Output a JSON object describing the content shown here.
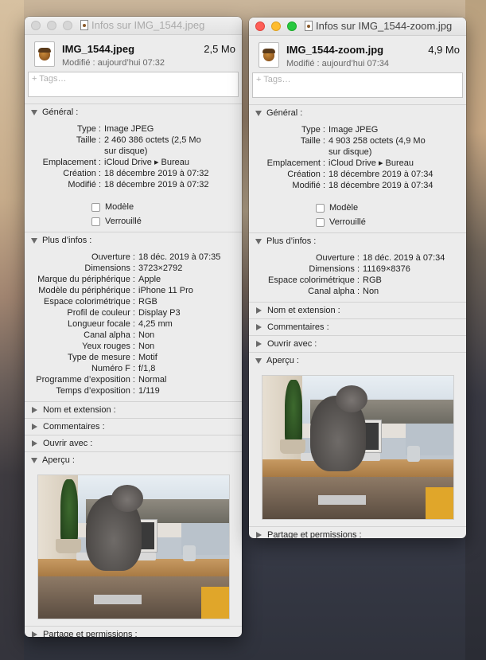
{
  "windows": [
    {
      "title": "Infos sur IMG_1544.jpeg",
      "filename": "IMG_1544.jpeg",
      "size": "2,5 Mo",
      "modified_line": "Modifié : aujourd’hui 07:32",
      "tags_placeholder": "+ Tags…",
      "general": {
        "label": "Général :",
        "type_k": "Type :",
        "type_v": "Image JPEG",
        "size_k": "Taille :",
        "size_v1": "2 460 386 octets (2,5 Mo",
        "size_v2": "sur disque)",
        "loc_k": "Emplacement :",
        "loc_v": "iCloud Drive ▸ Bureau",
        "created_k": "Création :",
        "created_v": "18 décembre 2019 à 07:32",
        "modified_k": "Modifié :",
        "modified_v": "18 décembre 2019 à 07:32",
        "template_label": "Modèle",
        "locked_label": "Verrouillé"
      },
      "more_info": {
        "label": "Plus d’infos :",
        "rows": [
          {
            "k": "Ouverture :",
            "v": "18 déc. 2019 à 07:35"
          },
          {
            "k": "Dimensions :",
            "v": "3723×2792"
          },
          {
            "k": "Marque du périphérique :",
            "v": "Apple"
          },
          {
            "k": "Modèle du périphérique :",
            "v": "iPhone 11 Pro"
          },
          {
            "k": "Espace colorimétrique :",
            "v": "RGB"
          },
          {
            "k": "Profil de couleur :",
            "v": "Display P3"
          },
          {
            "k": "Longueur focale :",
            "v": "4,25 mm"
          },
          {
            "k": "Canal alpha :",
            "v": "Non"
          },
          {
            "k": "Yeux rouges :",
            "v": "Non"
          },
          {
            "k": "Type de mesure :",
            "v": "Motif"
          },
          {
            "k": "Numéro F :",
            "v": "f/1,8"
          },
          {
            "k": "Programme d’exposition :",
            "v": "Normal"
          },
          {
            "k": "Temps d’exposition :",
            "v": "1/119"
          }
        ]
      },
      "name_ext": "Nom et extension :",
      "comments": "Commentaires :",
      "open_with": "Ouvrir avec :",
      "preview": "Aperçu :",
      "sharing": "Partage et permissions :"
    },
    {
      "title": "Infos sur IMG_1544-zoom.jpg",
      "filename": "IMG_1544-zoom.jpg",
      "size": "4,9 Mo",
      "modified_line": "Modifié : aujourd’hui 07:34",
      "tags_placeholder": "+ Tags…",
      "general": {
        "label": "Général :",
        "type_k": "Type :",
        "type_v": "Image JPEG",
        "size_k": "Taille :",
        "size_v1": "4 903 258 octets (4,9 Mo",
        "size_v2": "sur disque)",
        "loc_k": "Emplacement :",
        "loc_v": "iCloud Drive ▸ Bureau",
        "created_k": "Création :",
        "created_v": "18 décembre 2019 à 07:34",
        "modified_k": "Modifié :",
        "modified_v": "18 décembre 2019 à 07:34",
        "template_label": "Modèle",
        "locked_label": "Verrouillé"
      },
      "more_info": {
        "label": "Plus d’infos :",
        "rows": [
          {
            "k": "Ouverture :",
            "v": "18 déc. 2019 à 07:34"
          },
          {
            "k": "Dimensions :",
            "v": "11169×8376"
          },
          {
            "k": "Espace colorimétrique :",
            "v": "RGB"
          },
          {
            "k": "Canal alpha :",
            "v": "Non"
          }
        ]
      },
      "name_ext": "Nom et extension :",
      "comments": "Commentaires :",
      "open_with": "Ouvrir avec :",
      "preview": "Aperçu :",
      "sharing": "Partage et permissions :"
    }
  ]
}
